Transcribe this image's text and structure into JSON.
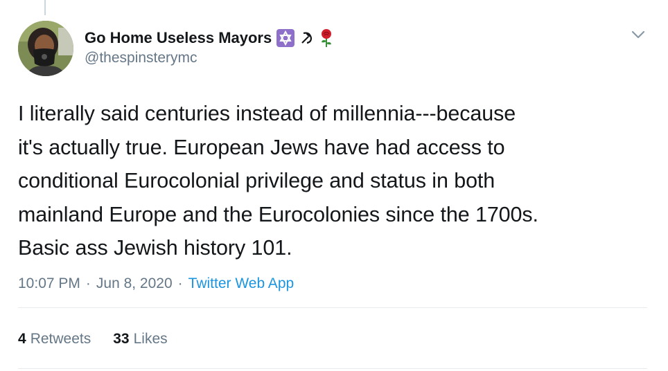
{
  "tweet": {
    "display_name": "Go Home Useless Mayors",
    "name_emojis": [
      "star-of-david-emoji",
      "hammer-and-sickle-emoji",
      "rose-emoji"
    ],
    "handle": "@thespinsterymc",
    "text": "I literally said centuries instead of millennia---because\nit's actually true. European Jews have had access to\nconditional Eurocolonial privilege and status in both\nmainland Europe and the Eurocolonies since the 1700s.\nBasic ass Jewish history 101.",
    "time": "10:07 PM",
    "separator": "·",
    "date": "Jun 8, 2020",
    "source": "Twitter Web App",
    "retweets_count": "4",
    "retweets_label": "Retweets",
    "likes_count": "33",
    "likes_label": "Likes"
  },
  "colors": {
    "text": "#14171a",
    "secondary": "#657786",
    "link": "#1b95e0",
    "divider": "#e6ecf0",
    "thread_line": "#ccd6dd"
  },
  "icons": {
    "caret": "chevron-down-icon"
  }
}
